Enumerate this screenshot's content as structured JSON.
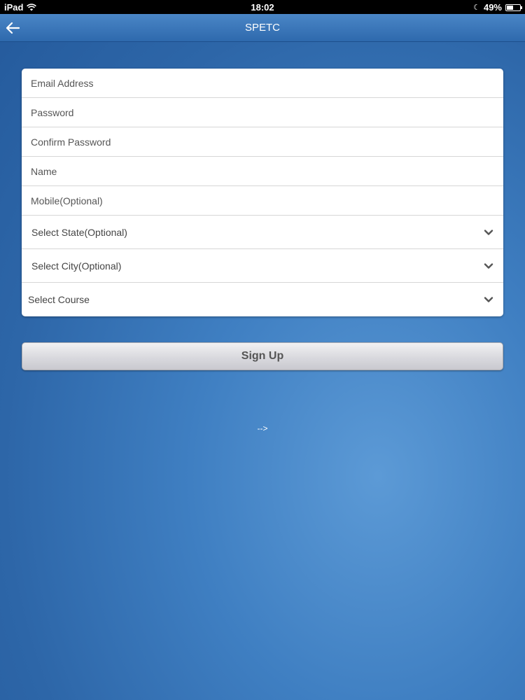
{
  "status_bar": {
    "device": "iPad",
    "time": "18:02",
    "battery": "49%",
    "battery_level": 0.49
  },
  "header": {
    "title": "SPETC",
    "back_icon": "back-arrow-icon"
  },
  "form": {
    "email": {
      "placeholder": "Email Address",
      "value": ""
    },
    "password": {
      "placeholder": "Password",
      "value": ""
    },
    "confirm_password": {
      "placeholder": "Confirm Password",
      "value": ""
    },
    "name": {
      "placeholder": "Name",
      "value": ""
    },
    "mobile": {
      "placeholder": "Mobile(Optional)",
      "value": ""
    },
    "state": {
      "label": "Select State(Optional)"
    },
    "city": {
      "label": "Select City(Optional)"
    },
    "course": {
      "label": "Select Course"
    }
  },
  "signup_button": "Sign Up",
  "stray_text": "-->",
  "colors": {
    "background": "#3f7fc2",
    "nav_bar": "#3a78ba",
    "card": "#ffffff",
    "button": "#d9d9de"
  }
}
